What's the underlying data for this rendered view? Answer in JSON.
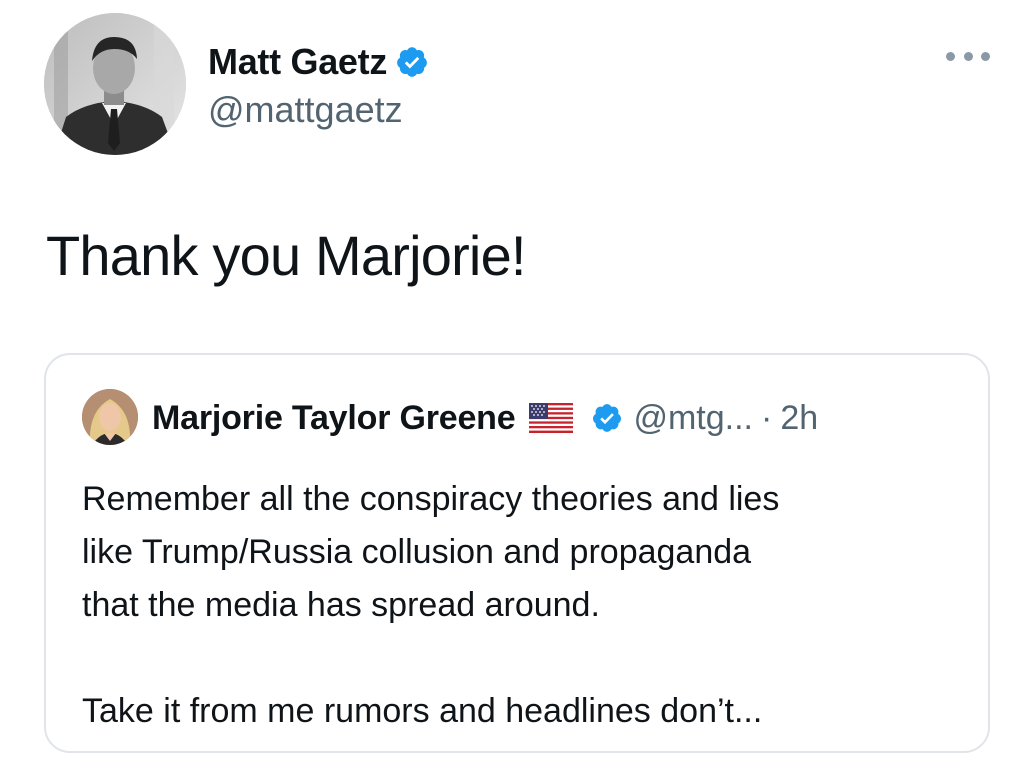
{
  "author": {
    "name": "Matt Gaetz",
    "handle": "@mattgaetz",
    "verified_icon": "verified-badge-icon",
    "more_icon": "more-options-icon"
  },
  "tweet": {
    "text": "Thank you Marjorie!"
  },
  "quoted_tweet": {
    "name": "Marjorie Taylor Greene",
    "flag_icon": "us-flag-icon",
    "verified_icon": "verified-badge-icon",
    "handle": "@mtg...",
    "separator": "·",
    "time": "2h",
    "body_lines": [
      "Remember all the conspiracy theories and lies",
      "like Trump/Russia collusion and propaganda",
      "that the media has spread around."
    ],
    "body_continuation": "Take it from me rumors and headlines don’t..."
  },
  "colors": {
    "text_primary": "#0f1419",
    "text_secondary": "#536471",
    "verified_blue": "#1d9bf0",
    "border": "#e1e4e8"
  }
}
